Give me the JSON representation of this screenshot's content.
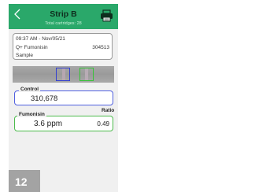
{
  "header": {
    "title": "Strip B",
    "subtitle": "Total cartridges: 28"
  },
  "test_info": {
    "timestamp": "09:37 AM - Nov/05/21",
    "test_name": "Q+ Fumonisin",
    "lot_number": "304513",
    "sample_label": "Sample"
  },
  "control": {
    "label": "Control",
    "value": "310,678"
  },
  "analyte": {
    "label": "Fumonisin",
    "value": "3.6 ppm",
    "ratio_label": "Ratio",
    "ratio_value": "0.49"
  },
  "step_number": "12",
  "colors": {
    "header_green": "#2aa86a",
    "control_outline": "#5060e0",
    "analyte_outline": "#4cbb4c",
    "strip_box_blue": "#3340d0",
    "strip_box_green": "#36c436"
  },
  "icons": [
    "back-chevron-icon",
    "printer-icon"
  ]
}
